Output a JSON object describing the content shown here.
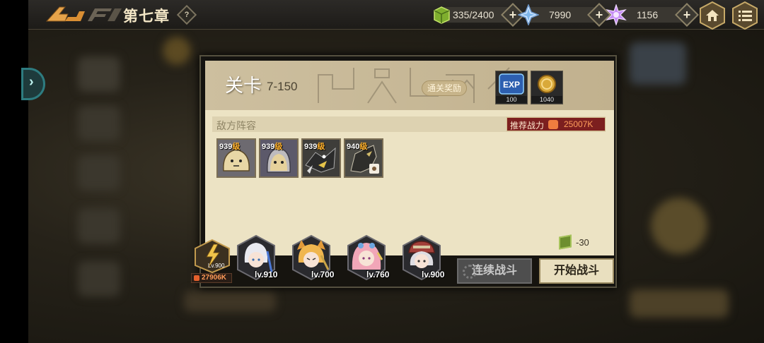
{
  "header": {
    "chapter_title": "第七章",
    "help_glyph": "?",
    "resources": [
      {
        "name": "stamina",
        "value": "335/2400",
        "plus": "+"
      },
      {
        "name": "crystal",
        "value": "7990",
        "plus": "+"
      },
      {
        "name": "star-gem",
        "value": "1156",
        "plus": "+"
      }
    ]
  },
  "side_tab": {
    "glyph": "›"
  },
  "stage": {
    "title": "关卡",
    "number": "7-150",
    "reward_button": "通关奖励",
    "rewards": [
      {
        "icon": "exp-icon",
        "label": "EXP",
        "count": "100"
      },
      {
        "icon": "gold-coin-icon",
        "count": "1040"
      }
    ]
  },
  "enemy": {
    "section_label": "敌方阵容",
    "recommended_label": "推荐战力",
    "recommended_power": "25007K",
    "level_suffix": "级",
    "units": [
      {
        "level": "939",
        "icon": "beige-blob-monster-icon"
      },
      {
        "level": "939",
        "icon": "ghost-blob-monster-icon"
      },
      {
        "level": "939",
        "icon": "dark-bird-monster-icon"
      },
      {
        "level": "940",
        "icon": "dark-dragon-monster-icon"
      }
    ]
  },
  "cost": {
    "value": "-30"
  },
  "team": {
    "leader": {
      "level": "Lv.900",
      "power": "27906K"
    },
    "heroes": [
      {
        "icon": "white-hair-hero-icon",
        "level": "lv.910"
      },
      {
        "icon": "cat-ear-hero-icon",
        "level": "lv.700"
      },
      {
        "icon": "pink-hair-hero-icon",
        "level": "lv.760"
      },
      {
        "icon": "red-cap-hero-icon",
        "level": "lv.900"
      }
    ]
  },
  "buttons": {
    "continuous_battle": "连续战斗",
    "start_battle": "开始战斗"
  },
  "colors": {
    "accent": "#e9dfbf",
    "power_red": "#7c1f1f",
    "panel": "#ece3c4"
  }
}
